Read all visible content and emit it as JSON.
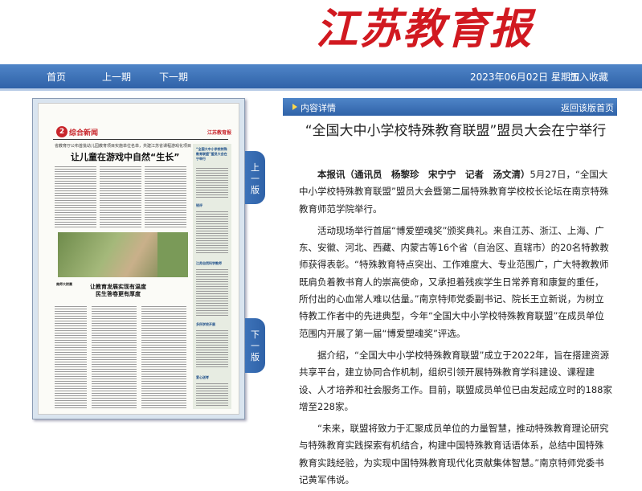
{
  "masthead": {
    "logo_text": "江苏教育报"
  },
  "nav": {
    "home": "首页",
    "prev_issue": "上一期",
    "next_issue": "下一期",
    "date": "2023年06月02日 星期五",
    "favorite": "加入收藏"
  },
  "page_image": {
    "page_number": "2",
    "section": "综合新闻",
    "mini_logo": "江苏教育报",
    "subhead": "省教育厅公布首批幼儿园教育项目实施单位名单，共建江苏省课程游戏化项目",
    "headline": "让儿童在游戏中自然“生长”",
    "headline2_line1": "让教育发展实现有温度",
    "headline2_line2": "民生答卷更有厚度",
    "small_head": "南师大附属",
    "side_titles": [
      "“全国大中小学校特殊教育联盟”盟员大会在宁举行",
      "锐评",
      "江苏自然科学教师",
      "多所学校开展",
      "爱心送考"
    ]
  },
  "tabs": {
    "up": [
      "上",
      "一",
      "版"
    ],
    "down": [
      "下",
      "一",
      "版"
    ]
  },
  "content": {
    "section_label": "内容详情",
    "back_label": "返回该版首页",
    "title": "“全国大中小学校特殊教育联盟”盟员大会在宁举行",
    "byline": "本报讯（通讯员　杨黎珍　宋宁宁　记者　汤文清）",
    "p1_rest": "5月27日，“全国大中小学校特殊教育联盟”盟员大会暨第二届特殊教育学校校长论坛在南京特殊教育师范学院举行。",
    "p2": "活动现场举行首届“博爱塑魂奖”颁奖典礼。来自江苏、浙江、上海、广东、安徽、河北、西藏、内蒙古等16个省（自治区、直辖市）的20名特教教师获得表彰。“特殊教育特点突出、工作难度大、专业范围广，广大特教教师既肩负着教书育人的崇高使命，又承担着残疾学生日常养育和康复的重任，所付出的心血常人难以估量。”南京特师党委副书记、院长王立新说，为树立特教工作者中的先进典型，今年“全国大中小学校特殊教育联盟”在成员单位范围内开展了第一届“博爱塑魂奖”评选。",
    "p3": "据介绍，“全国大中小学校特殊教育联盟”成立于2022年，旨在搭建资源共享平台，建立协同合作机制，组织引领开展特殊教育学科建设、课程建设、人才培养和社会服务工作。目前，联盟成员单位已由发起成立时的188家增至228家。",
    "p4": "“未来，联盟将致力于汇聚成员单位的力量智慧，推动特殊教育理论研究与特殊教育实践探索有机结合，构建中国特殊教育话语体系，总结中国特殊教育实践经验，为实现中国特殊教育现代化贡献集体智慧。”南京特师党委书记黄军伟说。"
  },
  "colors": {
    "brand_red": "#d11920",
    "nav_blue": "#2f62a8"
  }
}
